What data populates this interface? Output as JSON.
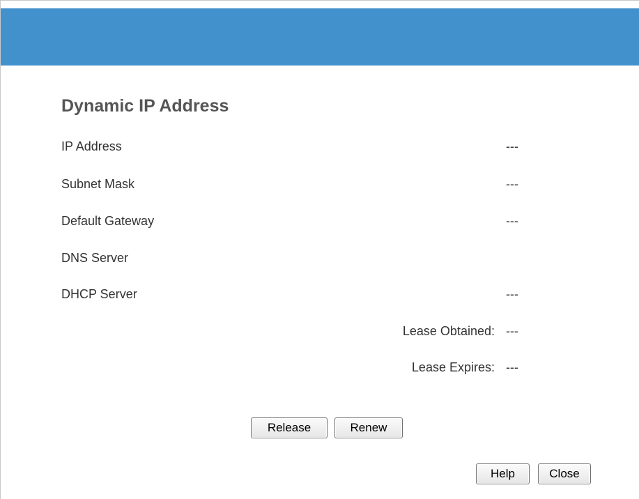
{
  "header": {
    "color": "#4290cc"
  },
  "section": {
    "title": "Dynamic IP Address"
  },
  "fields": {
    "ip_address": {
      "label": "IP Address",
      "value": "---"
    },
    "subnet_mask": {
      "label": "Subnet Mask",
      "value": "---"
    },
    "default_gateway": {
      "label": "Default Gateway",
      "value": "---"
    },
    "dns_server": {
      "label": "DNS Server",
      "value": ""
    },
    "dhcp_server": {
      "label": "DHCP Server",
      "value": "---"
    },
    "lease_obtained": {
      "label": "Lease Obtained:",
      "value": "---"
    },
    "lease_expires": {
      "label": "Lease Expires:",
      "value": "---"
    }
  },
  "buttons": {
    "release": "Release",
    "renew": "Renew",
    "help": "Help",
    "close": "Close"
  }
}
